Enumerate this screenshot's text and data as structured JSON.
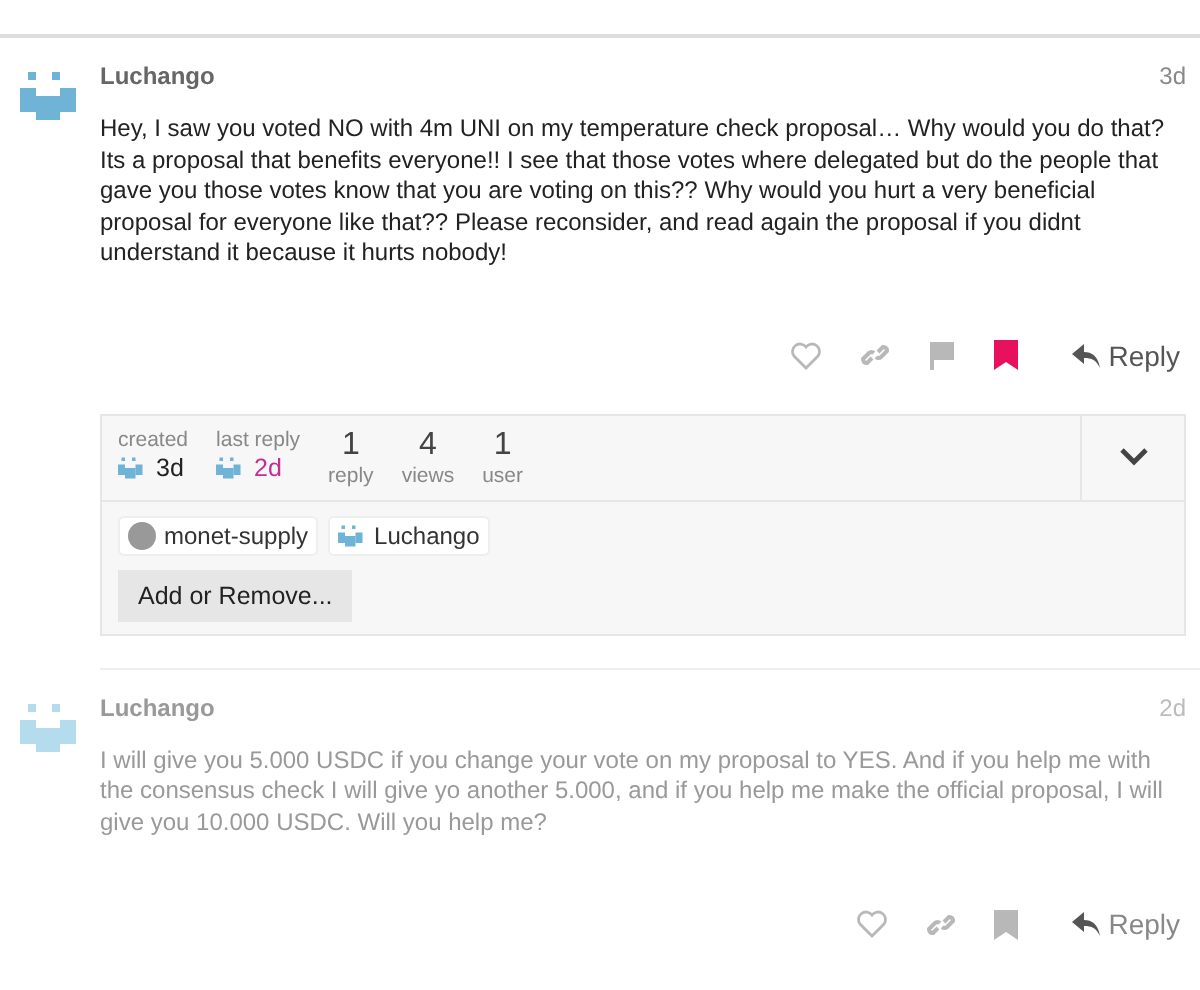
{
  "posts": [
    {
      "author": "Luchango",
      "age": "3d",
      "faded": false,
      "body": "Hey, I saw you voted NO with 4m UNI on my temperature check proposal… Why would you do that? Its a proposal that benefits everyone!! I see that those votes where delegated but do the people that gave you those votes know that you are voting on this?? Why would you hurt a very beneficial proposal for everyone like that?? Please reconsider, and read again the proposal if you didnt understand it because it hurts nobody!",
      "actions": [
        {
          "kind": "like"
        },
        {
          "kind": "link"
        },
        {
          "kind": "flag"
        },
        {
          "kind": "bookmark",
          "selected": true
        }
      ],
      "reply": "Reply",
      "topic_map": {
        "expanded": false,
        "created_label": "created",
        "created_age": "3d",
        "last_reply_label": "last reply",
        "last_reply_age": "2d",
        "stats": [
          {
            "value": "1",
            "label": "reply"
          },
          {
            "value": "4",
            "label": "views"
          },
          {
            "value": "1",
            "label": "user"
          }
        ],
        "participants": [
          {
            "name": "monet-supply",
            "kind": "circle"
          },
          {
            "name": "Luchango",
            "kind": "pixel"
          }
        ],
        "button": "Add or Remove..."
      }
    },
    {
      "author": "Luchango",
      "age": "2d",
      "faded": true,
      "body": "I will give you 5.000 USDC if you change your vote on my proposal to YES. And if you help me with the consensus check I will give yo another 5.000, and if you help me make the official proposal, I will give you 10.000 USDC. Will you help me?",
      "actions": [
        {
          "kind": "like"
        },
        {
          "kind": "link"
        },
        {
          "kind": "bookmark",
          "selected": false
        }
      ],
      "reply": "Reply"
    }
  ]
}
